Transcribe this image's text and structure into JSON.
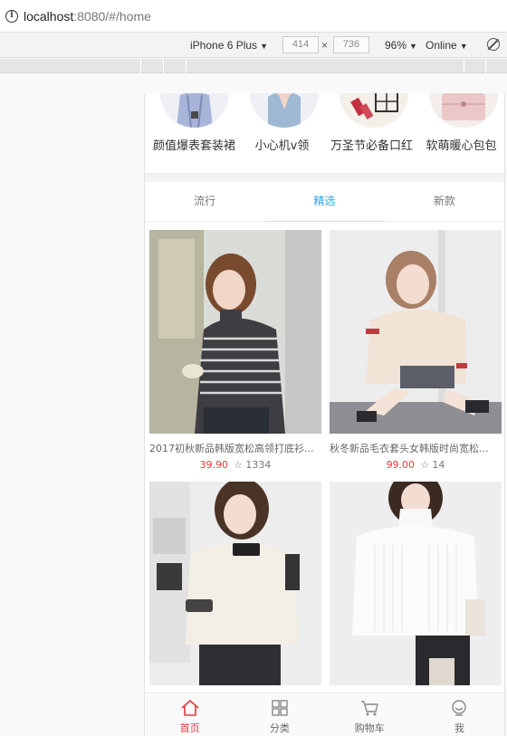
{
  "browser": {
    "url_host": "localhost",
    "url_rest": ":8080/#/home"
  },
  "devtools": {
    "device": "iPhone 6 Plus",
    "width": "414",
    "height": "736",
    "times": "×",
    "zoom": "96%",
    "network": "Online"
  },
  "categories": [
    {
      "label": "颜值爆表套装裙"
    },
    {
      "label": "小心机v领"
    },
    {
      "label": "万圣节必备口红"
    },
    {
      "label": "软萌暖心包包"
    }
  ],
  "tabs": [
    {
      "label": "流行"
    },
    {
      "label": "精选"
    },
    {
      "label": "新款"
    }
  ],
  "active_tab": "精选",
  "products": [
    {
      "title": "2017初秋新品韩版宽松高领打底衫...",
      "price": "39.90",
      "favs": "☆ 1334"
    },
    {
      "title": "秋冬新品毛衣套头女韩版时尚宽松...",
      "price": "99.00",
      "favs": "☆ 14"
    },
    {
      "title": "",
      "price": "",
      "favs": ""
    },
    {
      "title": "",
      "price": "",
      "favs": ""
    }
  ],
  "tabbar": [
    {
      "label": "首页",
      "icon": "home-icon"
    },
    {
      "label": "分类",
      "icon": "category-icon"
    },
    {
      "label": "购物车",
      "icon": "cart-icon"
    },
    {
      "label": "我",
      "icon": "profile-icon"
    }
  ],
  "colors": {
    "accent": "#29a6e6",
    "price": "#e4393c",
    "active_tabbar": "#e4393c"
  }
}
